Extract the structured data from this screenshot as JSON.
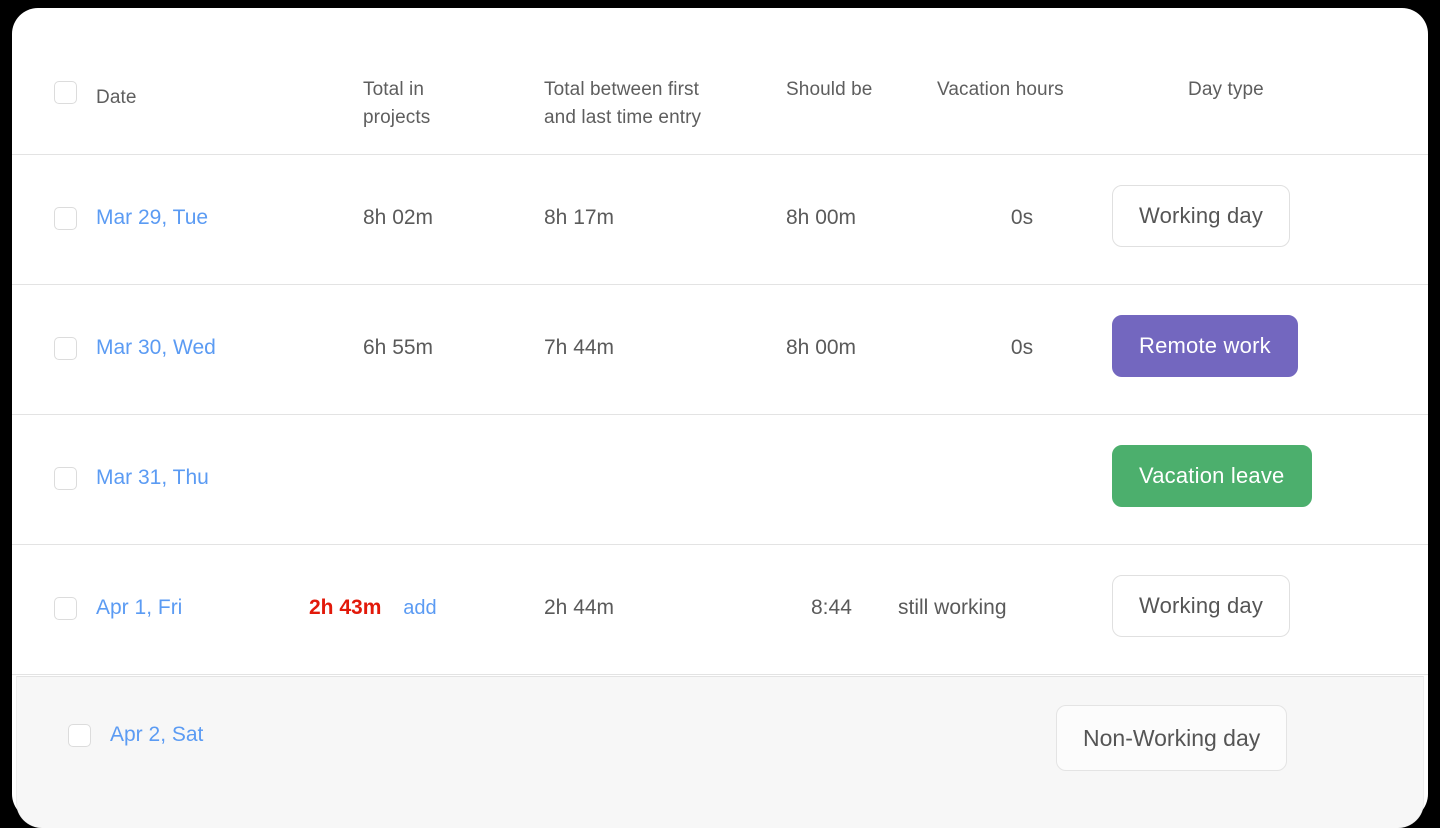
{
  "table": {
    "select_all_checkbox": "select-all",
    "columns": [
      {
        "key": "date",
        "label": "Date"
      },
      {
        "key": "total",
        "label": "Total in\nprojects",
        "line1": "Total in",
        "line2": "projects"
      },
      {
        "key": "between",
        "label": "Total between first and last time entry",
        "line1": "Total between first",
        "line2": "and last time entry"
      },
      {
        "key": "should",
        "label": "Should be"
      },
      {
        "key": "vacation",
        "label": "Vacation hours"
      },
      {
        "key": "daytype",
        "label": "Day type"
      }
    ],
    "rows": [
      {
        "date": "Mar 29, Tue",
        "total_in_projects": "8h 02m",
        "total_between": "8h 17m",
        "should_be": "8h 00m",
        "vacation_hours": "0s",
        "day_type": "Working day",
        "day_type_style": "outline",
        "add_link": "",
        "note": ""
      },
      {
        "date": "Mar 30, Wed",
        "total_in_projects": "6h 55m",
        "total_between": "7h 44m",
        "should_be": "8h 00m",
        "vacation_hours": "0s",
        "day_type": "Remote work",
        "day_type_style": "purple",
        "add_link": "",
        "note": ""
      },
      {
        "date": "Mar 31, Thu",
        "total_in_projects": "",
        "total_between": "",
        "should_be": "",
        "vacation_hours": "",
        "day_type": "Vacation leave",
        "day_type_style": "green",
        "add_link": "",
        "note": ""
      },
      {
        "date": "Apr 1, Fri",
        "total_in_projects": "2h 43m",
        "total_between": "2h 44m",
        "should_be": "8:44",
        "vacation_hours": "still working",
        "day_type": "Working day",
        "day_type_style": "outline",
        "add_link": "add",
        "note": "still working"
      }
    ],
    "footer_row": {
      "date": "Apr 2, Sat",
      "day_type": "Non-Working day",
      "day_type_style": "outline"
    }
  },
  "colors": {
    "link_blue": "#5b9bf3",
    "alert_red": "#e2190a",
    "badge_purple": "#7367bf",
    "badge_green": "#4caf6d",
    "text_grey": "#5a5a5a",
    "header_grey": "#5e5e5e",
    "divider": "#e3e3e3",
    "nonworking_bg": "#f7f7f7"
  }
}
